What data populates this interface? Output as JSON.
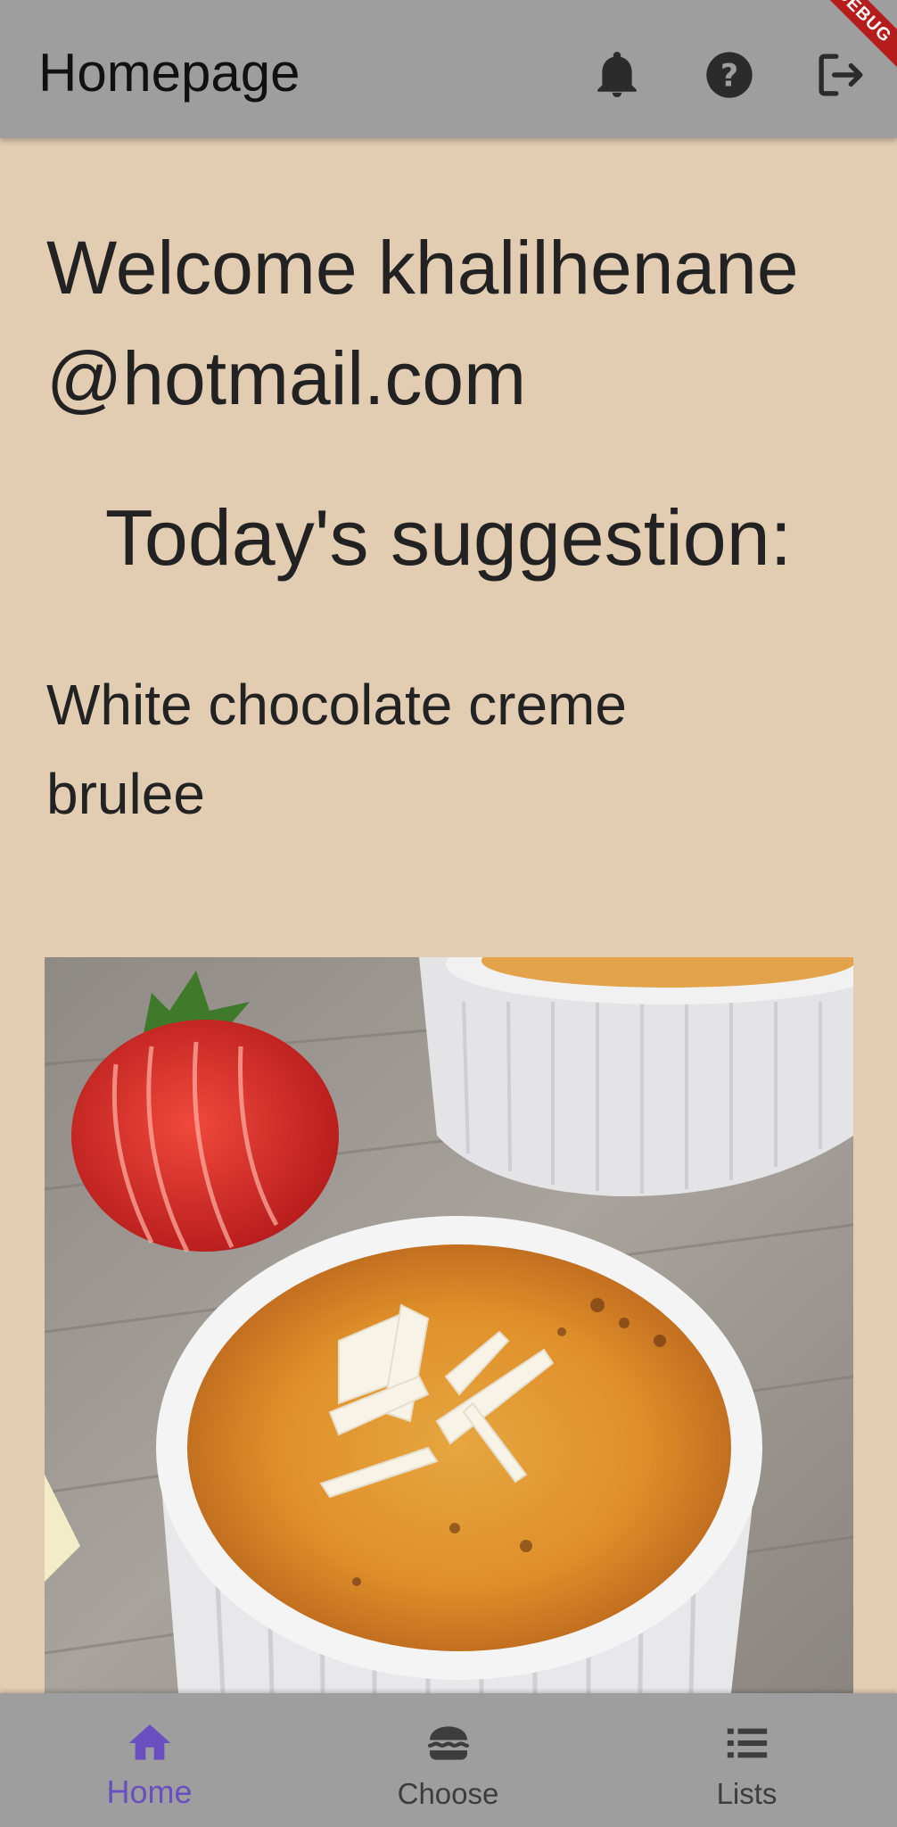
{
  "app_bar": {
    "title": "Homepage",
    "debug_banner": "DEBUG",
    "actions": [
      {
        "icon": "bell-icon",
        "label": "Notifications"
      },
      {
        "icon": "help-circle-icon",
        "label": "Help"
      },
      {
        "icon": "logout-icon",
        "label": "Logout"
      }
    ]
  },
  "main": {
    "welcome_text": "Welcome khalilhenane@hotmail.com",
    "suggestion_heading": "Today's suggestion:",
    "dish_name": "White chocolate creme brulee"
  },
  "bottom_nav": {
    "items": [
      {
        "label": "Home",
        "icon": "home-icon",
        "active": true
      },
      {
        "label": "Choose",
        "icon": "burger-icon",
        "active": false
      },
      {
        "label": "Lists",
        "icon": "list-icon",
        "active": false
      }
    ]
  },
  "colors": {
    "background": "#e2cdb3",
    "app_bar": "#9e9e9e",
    "active_nav": "#6a4fc0",
    "debug_banner": "#b71c1c"
  }
}
